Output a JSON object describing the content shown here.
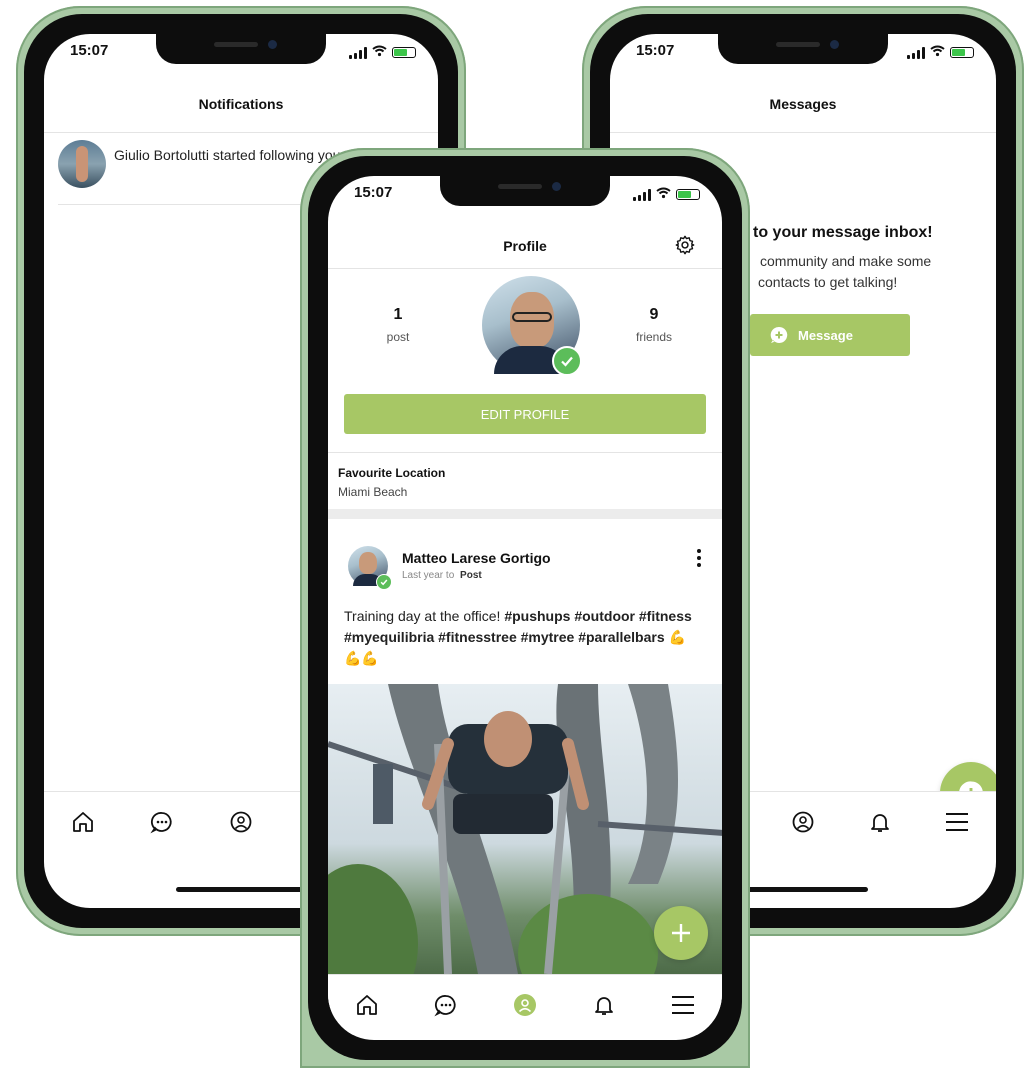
{
  "status": {
    "time": "15:07"
  },
  "notifications": {
    "title": "Notifications",
    "items": [
      {
        "text": "Giulio Bortolutti started following you"
      }
    ]
  },
  "messages": {
    "title": "Messages",
    "empty_title": "to your message inbox!",
    "empty_body_line1": "community and make some",
    "empty_body_line2": "contacts to get talking!",
    "button_label": "Message"
  },
  "profile": {
    "title": "Profile",
    "posts_count": "1",
    "posts_label": "post",
    "friends_count": "9",
    "friends_label": "friends",
    "edit_button": "EDIT PROFILE",
    "favourite_location_label": "Favourite Location",
    "favourite_location_value": "Miami Beach",
    "post": {
      "author": "Matteo Larese Gortigo",
      "meta_prefix": "Last year to",
      "meta_target": "Post",
      "text_plain": "Training day at the office!",
      "hashtags": "#pushups #outdoor #fitness #myequilibria #fitnesstree #mytree #parallelbars",
      "emoji": "💪💪💪"
    }
  },
  "tabbar": [
    "home-icon",
    "chat-icon",
    "profile-icon",
    "bell-icon",
    "menu-icon"
  ],
  "colors": {
    "accent": "#a7c765",
    "verified": "#5cbd5a",
    "frame": "#a9c9a5"
  }
}
